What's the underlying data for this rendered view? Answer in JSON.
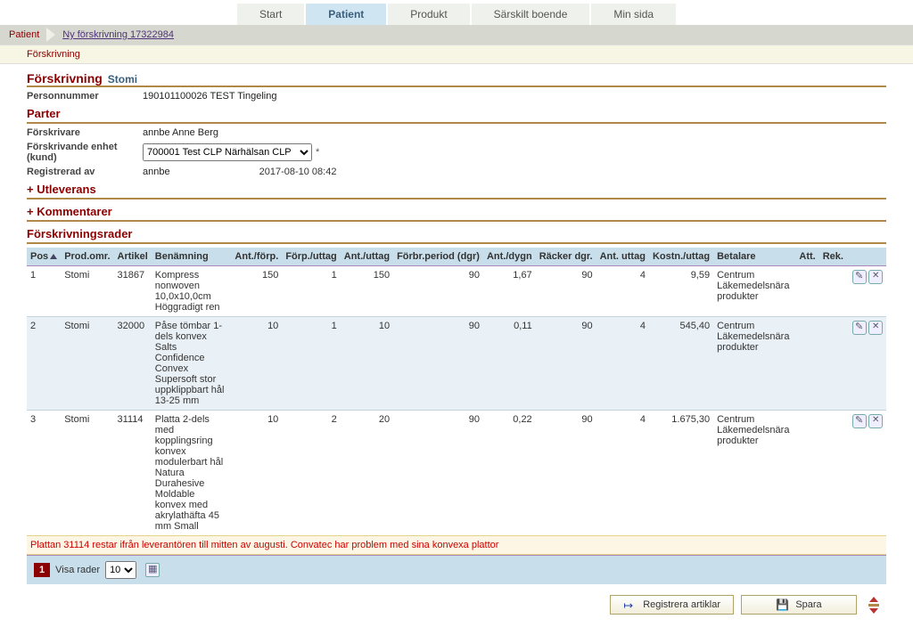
{
  "topnav": {
    "items": [
      "Start",
      "Patient",
      "Produkt",
      "Särskilt boende",
      "Min sida"
    ],
    "active": "Patient"
  },
  "breadcrumb": {
    "root": "Patient",
    "current": "Ny förskrivning 17322984"
  },
  "subtab": "Förskrivning",
  "header": {
    "title": "Förskrivning",
    "subtitle": "Stomi"
  },
  "person": {
    "label": "Personnummer",
    "value": "190101100026 TEST Tingeling"
  },
  "parties": {
    "title": "Parter",
    "prescriber_label": "Förskrivare",
    "prescriber_value": "annbe Anne Berg",
    "unit_label": "Förskrivande enhet (kund)",
    "unit_selected": "700001 Test CLP Närhälsan CLP",
    "registered_label": "Registrerad av",
    "registered_by": "annbe",
    "registered_dt": "2017-08-10 08:42"
  },
  "sections": {
    "delivery": "+ Utleverans",
    "comments": "+ Kommentarer",
    "rows_title": "Förskrivningsrader"
  },
  "columns": {
    "pos": "Pos",
    "prodarea": "Prod.omr.",
    "article": "Artikel",
    "name": "Benämning",
    "perpack": "Ant./förp.",
    "packper": "Förp./uttag",
    "perw": "Ant./uttag",
    "period": "Förbr.period (dgr)",
    "perday": "Ant./dygn",
    "lasts": "Räcker dgr.",
    "nw": "Ant. uttag",
    "cost": "Kostn./uttag",
    "payer": "Betalare",
    "att": "Att.",
    "rek": "Rek."
  },
  "rows": [
    {
      "pos": "1",
      "area": "Stomi",
      "art": "31867",
      "name": "Kompress nonwoven 10,0x10,0cm Höggradigt ren",
      "perpack": "150",
      "packper": "1",
      "perw": "150",
      "period": "90",
      "perday": "1,67",
      "lasts": "90",
      "nw": "4",
      "cost": "9,59",
      "payer": "Centrum Läkemedelsnära produkter"
    },
    {
      "pos": "2",
      "area": "Stomi",
      "art": "32000",
      "name": "Påse tömbar 1-dels konvex Salts Confidence Convex Supersoft stor uppklippbart hål 13-25 mm",
      "perpack": "10",
      "packper": "1",
      "perw": "10",
      "period": "90",
      "perday": "0,11",
      "lasts": "90",
      "nw": "4",
      "cost": "545,40",
      "payer": "Centrum Läkemedelsnära produkter"
    },
    {
      "pos": "3",
      "area": "Stomi",
      "art": "31114",
      "name": "Platta 2-dels med kopplingsring konvex modulerbart hål Natura Durahesive Moldable konvex med akrylathäfta 45 mm Small",
      "perpack": "10",
      "packper": "2",
      "perw": "20",
      "period": "90",
      "perday": "0,22",
      "lasts": "90",
      "nw": "4",
      "cost": "1.675,30",
      "payer": "Centrum Läkemedelsnära produkter"
    }
  ],
  "warning": "Plattan 31114 restar ifrån leverantören till mitten av augusti. Convatec har problem med sina konvexa plattor",
  "pager": {
    "page": "1",
    "show_label": "Visa rader",
    "show_value": "10"
  },
  "buttons": {
    "register": "Registrera artiklar",
    "save": "Spara"
  }
}
